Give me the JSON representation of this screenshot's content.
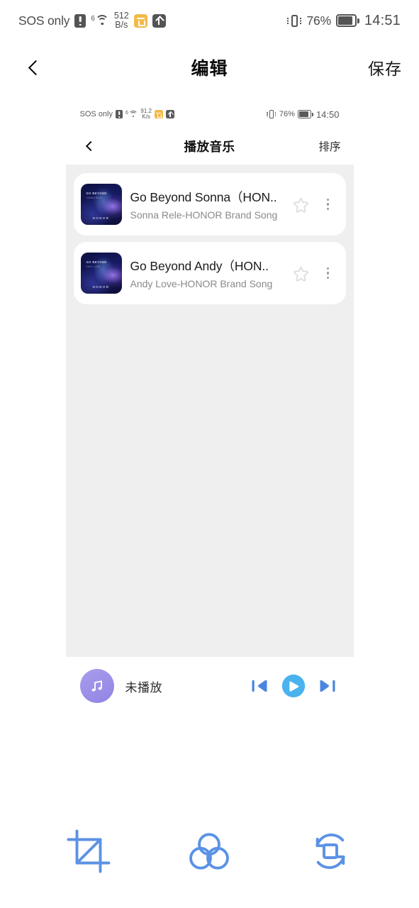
{
  "status_bar": {
    "carrier": "SOS only",
    "alert_icon": "alert-icon",
    "network_gen": "6",
    "wifi_icon": "wifi-icon",
    "speed_value": "512",
    "speed_unit": "B/s",
    "upload_badge_icon": "sync-badge-icon",
    "vpn_badge_icon": "upload-badge-icon",
    "vibrate_icon": "vibrate-icon",
    "battery_percent": "76%",
    "battery_icon": "battery-icon",
    "time": "14:51"
  },
  "app_bar": {
    "back_icon": "chevron-left-icon",
    "title": "编辑",
    "save_label": "保存"
  },
  "inner_screenshot": {
    "status_bar": {
      "carrier": "SOS only",
      "alert_icon": "alert-icon",
      "network_gen": "6",
      "wifi_icon": "wifi-icon",
      "speed_value": "91.2",
      "speed_unit": "K/s",
      "upload_badge_icon": "sync-badge-icon",
      "vpn_badge_icon": "upload-badge-icon",
      "vibrate_icon": "vibrate-icon",
      "battery_percent": "76%",
      "battery_icon": "battery-icon",
      "time": "14:50"
    },
    "app_bar": {
      "back_icon": "chevron-left-icon",
      "title": "播放音乐",
      "sort_label": "排序"
    },
    "songs": [
      {
        "title": "Go Beyond Sonna（HON..",
        "artist": "Sonna Rele-HONOR Brand Song",
        "art_top_text": "GO BEYOND",
        "art_sub_text": "SONNA RELE",
        "art_brand_text": "HONOR",
        "star_icon": "star-outline-icon",
        "menu_icon": "more-vertical-icon"
      },
      {
        "title": "Go Beyond Andy（HON..",
        "artist": "Andy Love-HONOR Brand Song",
        "art_top_text": "GO BEYOND",
        "art_sub_text": "ANDY LOVE",
        "art_brand_text": "HONOR",
        "star_icon": "star-outline-icon",
        "menu_icon": "more-vertical-icon"
      }
    ],
    "player": {
      "thumb_icon": "music-note-icon",
      "now_playing_label": "未播放",
      "previous_icon": "skip-previous-icon",
      "play_icon": "play-circle-icon",
      "next_icon": "skip-next-icon"
    }
  },
  "edit_toolbar": {
    "tools": [
      {
        "icon": "crop-icon"
      },
      {
        "icon": "color-filter-icon"
      },
      {
        "icon": "rotate-resize-icon"
      }
    ]
  },
  "colors": {
    "accent_blue": "#5b92e5",
    "play_blue": "#4ab3ef",
    "control_blue": "#4a86e0",
    "thumb_purple": "#9b8fe8",
    "list_background": "#f0eff0",
    "status_gray": "#545454"
  }
}
